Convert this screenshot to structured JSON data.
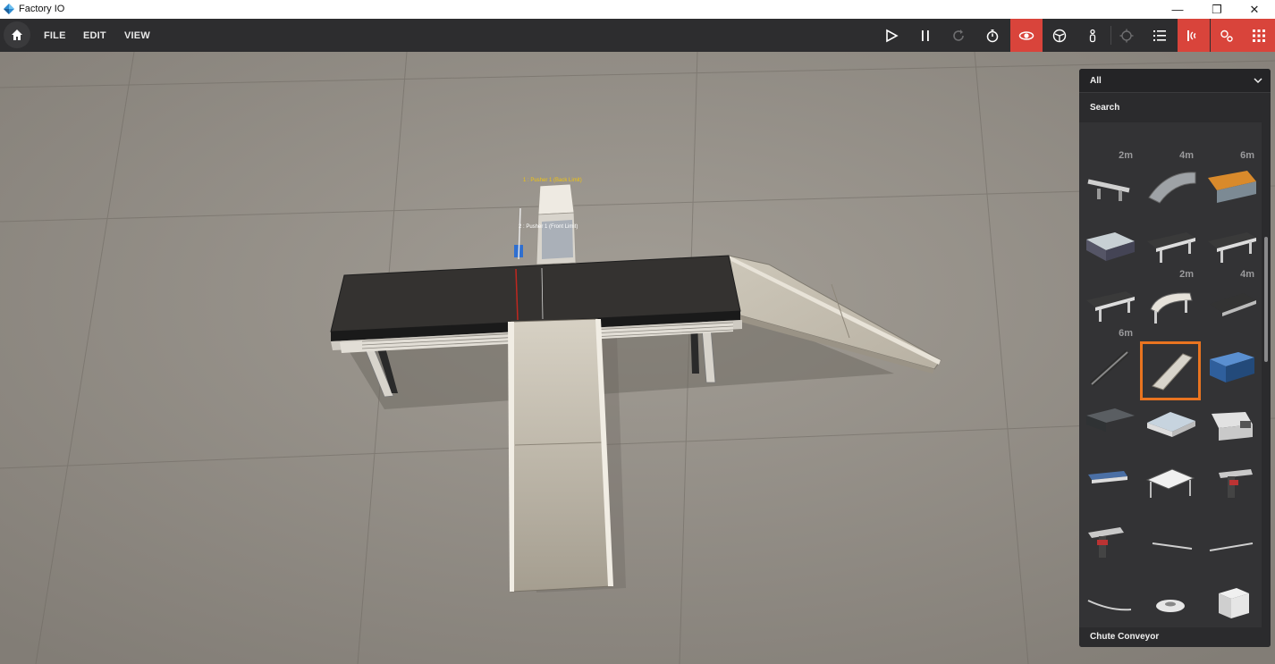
{
  "window": {
    "title": "Factory IO",
    "minimize": "—",
    "maximize": "❐",
    "close": "✕"
  },
  "menu": {
    "file": "FILE",
    "edit": "EDIT",
    "view": "VIEW"
  },
  "toolbar": {
    "tools": [
      {
        "name": "play-icon",
        "active": false
      },
      {
        "name": "pause-icon",
        "active": false
      },
      {
        "name": "reset-icon",
        "active": false
      },
      {
        "name": "timer-icon",
        "active": false
      },
      {
        "name": "orbit-camera-icon",
        "active": true
      },
      {
        "name": "fly-camera-icon",
        "active": false
      },
      {
        "name": "first-person-icon",
        "active": false
      },
      {
        "name": "target-icon",
        "active": false
      },
      {
        "name": "list-icon",
        "active": false
      },
      {
        "name": "sensors-icon",
        "active": true
      },
      {
        "name": "drivers-icon",
        "active": true
      },
      {
        "name": "palette-icon",
        "active": true
      }
    ],
    "accent": "#d9443b"
  },
  "scene": {
    "sensor_label_top": "1 : Pusher 1 (Back Limit)",
    "sensor_label_mid": "2 : Pusher 1 (Front Limit)"
  },
  "palette": {
    "filter": "All",
    "search_label": "Search",
    "selected_item": "Chute Conveyor",
    "selected_color": "#e97420",
    "items": [
      {
        "icon": "roller-conveyor-2m-icon",
        "len": "2m"
      },
      {
        "icon": "roller-conveyor-4m-icon",
        "len": "4m"
      },
      {
        "icon": "roller-conveyor-6m-icon",
        "len": "6m"
      },
      {
        "icon": "light-roller-conveyor-icon",
        "len": ""
      },
      {
        "icon": "curved-roller-conveyor-icon",
        "len": ""
      },
      {
        "icon": "heavy-roller-conveyor-icon",
        "len": ""
      },
      {
        "icon": "roller-transfer-icon",
        "len": ""
      },
      {
        "icon": "belt-conveyor-2m-icon",
        "len": "2m"
      },
      {
        "icon": "belt-conveyor-4m-icon",
        "len": "4m"
      },
      {
        "icon": "belt-conveyor-6m-icon",
        "len": "6m"
      },
      {
        "icon": "curved-belt-conveyor-icon",
        "len": ""
      },
      {
        "icon": "light-belt-conveyor-icon",
        "len": ""
      },
      {
        "icon": "roller-chute-icon",
        "len": ""
      },
      {
        "icon": "chute-conveyor-icon",
        "len": ""
      },
      {
        "icon": "heavy-pallet-conveyor-icon",
        "len": ""
      },
      {
        "icon": "spiral-conveyor-icon",
        "len": ""
      },
      {
        "icon": "transfer-table-icon",
        "len": ""
      },
      {
        "icon": "turntable-icon",
        "len": ""
      },
      {
        "icon": "pusher-icon",
        "len": ""
      },
      {
        "icon": "lift-transfer-icon",
        "len": ""
      },
      {
        "icon": "pivot-arm-sorter-icon",
        "len": ""
      },
      {
        "icon": "pop-up-wheel-sorter-icon",
        "len": ""
      },
      {
        "icon": "side-guide-icon",
        "len": ""
      },
      {
        "icon": "side-guide-long-icon",
        "len": ""
      },
      {
        "icon": "curved-side-guide-icon",
        "len": ""
      },
      {
        "icon": "round-stopper-icon",
        "len": ""
      },
      {
        "icon": "box-icon",
        "len": ""
      }
    ]
  }
}
